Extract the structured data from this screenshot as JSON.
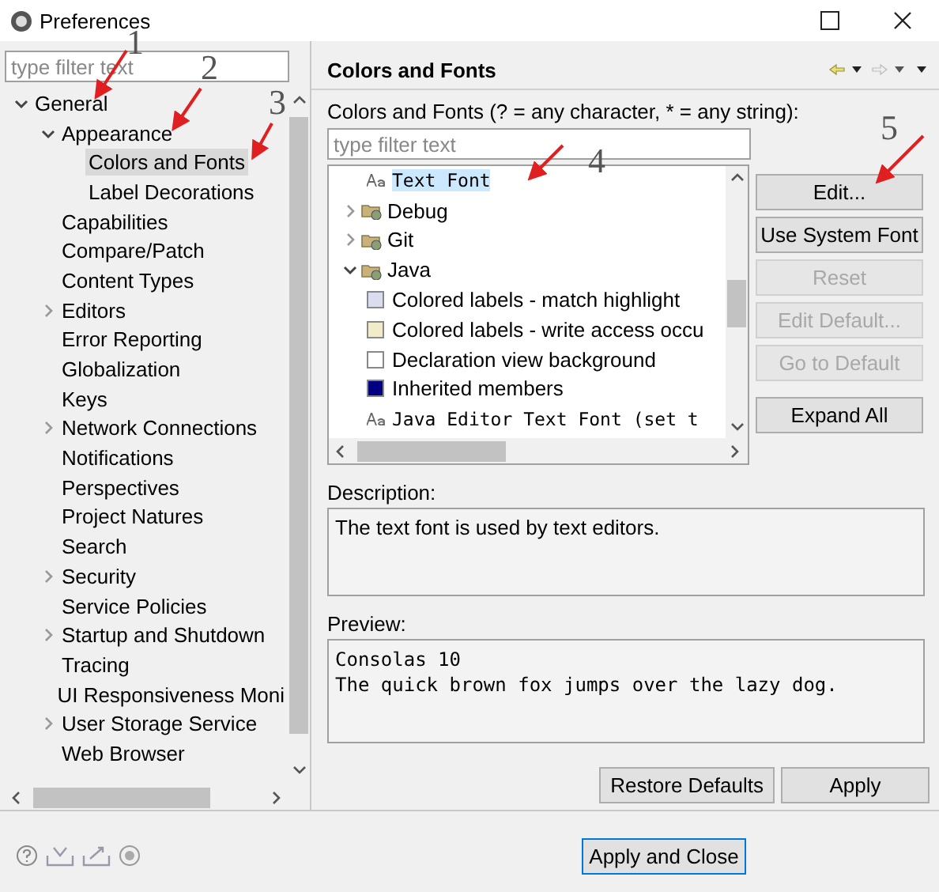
{
  "window": {
    "title": "Preferences"
  },
  "filter": {
    "placeholder": "type filter text"
  },
  "tree": [
    {
      "label": "General",
      "selected": false,
      "expanded": true,
      "children": [
        {
          "label": "Appearance",
          "selected": false,
          "expanded": true,
          "children": [
            {
              "label": "Colors and Fonts",
              "selected": true
            },
            {
              "label": "Label Decorations",
              "selected": false
            }
          ]
        },
        {
          "label": "Capabilities",
          "selected": false
        },
        {
          "label": "Compare/Patch",
          "selected": false
        },
        {
          "label": "Content Types",
          "selected": false
        },
        {
          "label": "Editors",
          "selected": false,
          "expanded": false
        },
        {
          "label": "Error Reporting",
          "selected": false
        },
        {
          "label": "Globalization",
          "selected": false
        },
        {
          "label": "Keys",
          "selected": false
        },
        {
          "label": "Network Connections",
          "selected": false,
          "expanded": false
        },
        {
          "label": "Notifications",
          "selected": false
        },
        {
          "label": "Perspectives",
          "selected": false
        },
        {
          "label": "Project Natures",
          "selected": false
        },
        {
          "label": "Search",
          "selected": false
        },
        {
          "label": "Security",
          "selected": false,
          "expanded": false
        },
        {
          "label": "Service Policies",
          "selected": false
        },
        {
          "label": "Startup and Shutdown",
          "selected": false,
          "expanded": false
        },
        {
          "label": "Tracing",
          "selected": false
        },
        {
          "label": "UI Responsiveness Moni",
          "selected": false
        },
        {
          "label": "User Storage Service",
          "selected": false,
          "expanded": false
        },
        {
          "label": "Web Browser",
          "selected": false
        }
      ]
    }
  ],
  "page": {
    "title": "Colors and Fonts",
    "hint": "Colors and Fonts (? = any character, * = any string):",
    "filter_placeholder": "type filter text",
    "items": [
      {
        "kind": "font",
        "label": "Text Font",
        "selected": true
      },
      {
        "kind": "category",
        "label": "Debug",
        "selected": false,
        "expanded": false
      },
      {
        "kind": "category",
        "label": "Git",
        "selected": false,
        "expanded": false
      },
      {
        "kind": "category",
        "label": "Java",
        "selected": false,
        "expanded": true,
        "children": [
          {
            "kind": "color",
            "label": "Colored labels - match highlight",
            "selected": false,
            "color": "#dcdcf0"
          },
          {
            "kind": "color",
            "label": "Colored labels - write access occu",
            "selected": false,
            "color": "#f0ecc8"
          },
          {
            "kind": "color",
            "label": "Declaration view background",
            "selected": false,
            "color": "#ffffff"
          },
          {
            "kind": "color",
            "label": "Inherited members",
            "selected": false,
            "color": "#000080"
          },
          {
            "kind": "font",
            "label": "Java Editor Text Font (set t",
            "selected": false
          }
        ]
      }
    ],
    "buttons": [
      {
        "label": "Edit...",
        "disabled": false
      },
      {
        "label": "Use System Font",
        "disabled": false
      },
      {
        "label": "Reset",
        "disabled": true
      },
      {
        "label": "Edit Default...",
        "disabled": true
      },
      {
        "label": "Go to Default",
        "disabled": true
      }
    ],
    "expand_all": "Expand All",
    "description_label": "Description:",
    "description": "The text font is used by text editors.",
    "preview_label": "Preview:",
    "preview": [
      "Consolas 10",
      "The quick brown fox jumps over the lazy dog."
    ],
    "restore_defaults": "Restore Defaults",
    "apply": "Apply"
  },
  "apply_and_close": "Apply and Close",
  "annotations": [
    {
      "label": "1"
    },
    {
      "label": "2"
    },
    {
      "label": "3"
    },
    {
      "label": "4"
    },
    {
      "label": "5"
    }
  ]
}
